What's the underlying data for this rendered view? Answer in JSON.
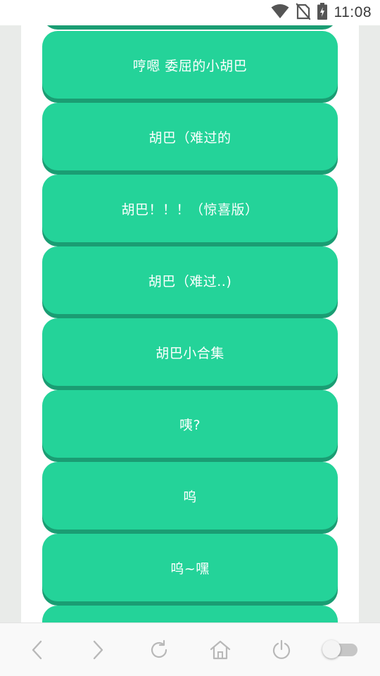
{
  "status_bar": {
    "time": "11:08",
    "icons": [
      "wifi-icon",
      "no-sim-icon",
      "battery-charging-icon"
    ]
  },
  "colors": {
    "button": "#24d399",
    "button_shadow": "#1a9d73",
    "page_background": "#e9ebe9",
    "nav_icon": "#b8b8b8"
  },
  "buttons": [
    {
      "label": ""
    },
    {
      "label": "哼嗯 委屈的小胡巴"
    },
    {
      "label": "胡巴（难过的"
    },
    {
      "label": "胡巴！！！（惊喜版）"
    },
    {
      "label": "胡巴（难过..)"
    },
    {
      "label": "胡巴小合集"
    },
    {
      "label": "咦?"
    },
    {
      "label": "呜"
    },
    {
      "label": "呜~嘿"
    },
    {
      "label": ""
    }
  ],
  "bottom_nav": {
    "items": [
      "back-icon",
      "forward-icon",
      "refresh-icon",
      "home-icon",
      "power-icon"
    ],
    "toggle_on": false
  }
}
